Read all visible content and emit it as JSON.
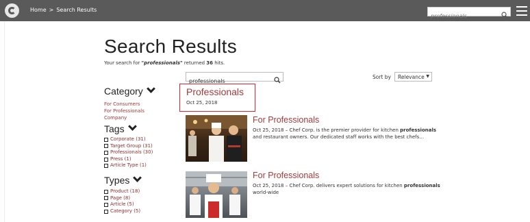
{
  "topbar": {
    "breadcrumb": [
      "Home",
      ">",
      "Search Results"
    ],
    "search_value": "professionals"
  },
  "page": {
    "title": "Search Results",
    "summary_prefix": "Your search for ",
    "query_quoted": "\"professionals\"",
    "summary_mid": " returned ",
    "hits": "36",
    "summary_suffix": " hits."
  },
  "search": {
    "value": "professionals"
  },
  "sort": {
    "label": "Sort by",
    "selected": "Relevance"
  },
  "facets": {
    "category": {
      "title": "Category",
      "items": [
        "For Consumers",
        "For Professionals",
        "Company"
      ]
    },
    "tags": {
      "title": "Tags",
      "items": [
        "Corporate (31)",
        "Target Group (31)",
        "Professionals (30)",
        "Press (1)",
        "Article Type (1)"
      ]
    },
    "types": {
      "title": "Types",
      "items": [
        "Product (18)",
        "Page (8)",
        "Article (5)",
        "Category (5)"
      ]
    }
  },
  "results": [
    {
      "title": "Professionals",
      "date": "Oct 25, 2018"
    },
    {
      "title": "For Professionals",
      "date": "Oct 25, 2018",
      "dash": " – ",
      "snippet_pre": "Chef Corp. is the premier provider for kitchen ",
      "snippet_bold": "professionals",
      "snippet_post": " and restaurant owners. Our dedicated staff works with the best chefs..."
    },
    {
      "title": "For Professionals",
      "date": "Oct 25, 2018",
      "dash": " – ",
      "snippet_pre": "Chef Corp. delivers expert solutions for kitchen ",
      "snippet_bold": "professionals",
      "snippet_post": " world-wide"
    }
  ],
  "colors": {
    "topbar": "#5a5a5a",
    "link": "#a33b3b",
    "highlight_border": "#d9262b"
  },
  "icons": [
    "logo-icon",
    "search-icon",
    "menu-icon",
    "chevron-down-icon",
    "checkbox-icon"
  ]
}
